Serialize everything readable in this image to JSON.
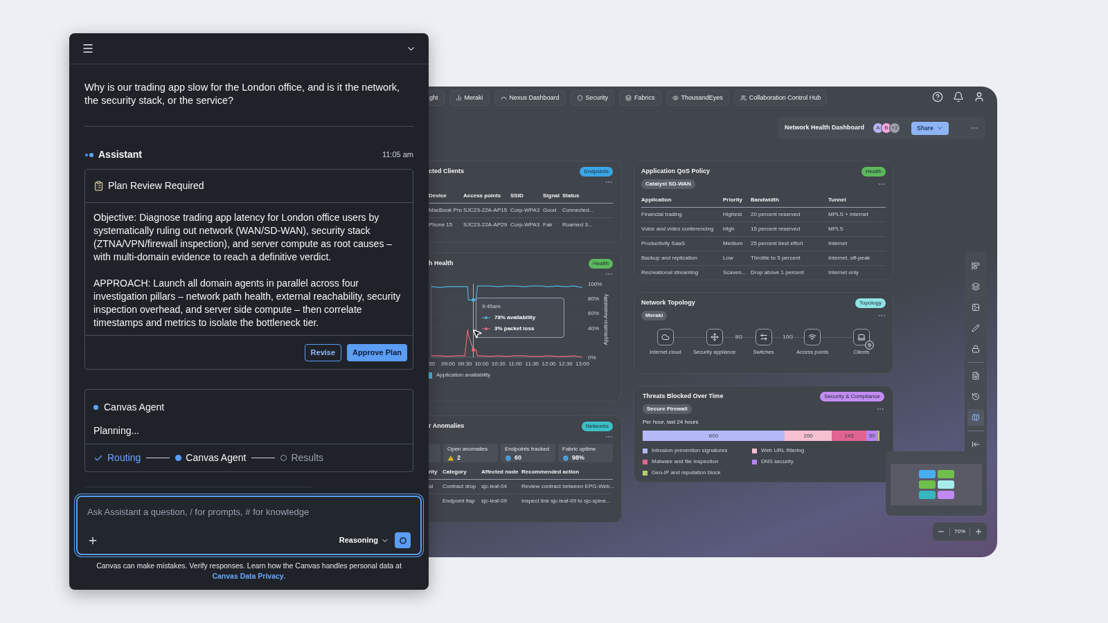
{
  "chat": {
    "question": "Why is our trading app slow for the London office, and is it the network, the security stack, or the service?",
    "assistant": {
      "name": "Assistant",
      "time": "11:05 am"
    },
    "plan": {
      "title": "Plan Review Required",
      "paragraphs": [
        "Objective: Diagnose trading app latency for London office users by systematically ruling out network (WAN/SD-WAN), security stack (ZTNA/VPN/firewall inspection), and server compute as root causes – with multi-domain evidence to reach a definitive verdict.",
        "APPROACH: Launch all domain agents in parallel across four investigation pillars – network path health, external reachability, security inspection overhead, and server side compute – then correlate timestamps and metrics to isolate the bottleneck tier."
      ],
      "buttons": [
        {
          "label": "Revise",
          "kind": "outline"
        },
        {
          "label": "Approve Plan",
          "kind": "primary"
        }
      ]
    },
    "agent": {
      "name": "Canvas Agent",
      "status": "Planning...",
      "steps": [
        {
          "label": "Routing",
          "done": true,
          "active": false
        },
        {
          "label": "Canvas Agent",
          "done": false,
          "active": true
        },
        {
          "label": "Results",
          "done": false,
          "active": false
        }
      ]
    },
    "input": {
      "placeholder": "Ask Assistant a question, / for prompts, # for knowledge",
      "mode": "Reasoning"
    },
    "footer": {
      "text": "Canvas can make mistakes. Verify responses. Learn how the Canvas handles personal data at",
      "link": "Canvas Data Privacy",
      "end": "."
    }
  },
  "dashboard": {
    "tabs": [
      "ght",
      "Meraki",
      "Nexus Dashboard",
      "Security",
      "Fabrics",
      "ThousandEyes",
      "Collaboration Control Hub"
    ],
    "header": {
      "title": "Network Health Dashboard",
      "avatars": [
        {
          "text": "A",
          "color": "#b8b5f3"
        },
        {
          "text": "B",
          "color": "#f2a7dc"
        },
        {
          "text": "+2",
          "color": "#9ca0a8"
        }
      ],
      "share": "Share"
    },
    "clients": {
      "title": "cted Clients",
      "badge": {
        "label": "Endpoints",
        "color": "#3aa6e6"
      },
      "columns": [
        "Device",
        "Access points",
        "SSID",
        "Signal",
        "Status"
      ],
      "rows": [
        [
          "MacBook Pro",
          "SJC23-22A-AP15",
          "Corp-WPA3",
          "Good",
          "Connected..."
        ],
        [
          "Phone 15",
          "SJC23-22A-AP29",
          "Corp-WPA3",
          "Fair",
          "Roamed 3..."
        ]
      ]
    },
    "health": {
      "title": "h Health",
      "cut_tick": "30",
      "badge": {
        "label": "Health",
        "color": "#5cb85c"
      },
      "tooltip": {
        "time": "9:45am",
        "lines": [
          "78% availability",
          "3% packet loss"
        ]
      },
      "chart_data": {
        "type": "line",
        "ylabel": "Application Availability",
        "xlim": [
          8.5,
          13
        ],
        "ylim": [
          0,
          100
        ],
        "x": [
          8.5,
          8.75,
          9,
          9.25,
          9.5,
          9.58,
          9.6,
          9.75,
          9.83,
          9.87,
          10,
          10.25,
          10.5,
          10.75,
          11,
          11.25,
          11.5,
          11.75,
          12,
          12.25,
          12.5,
          12.75,
          13
        ],
        "xticks": [
          {
            "value": 9,
            "label": "09:00"
          },
          {
            "value": 9.5,
            "label": "09:30"
          },
          {
            "value": 10,
            "label": "10:00"
          },
          {
            "value": 10.5,
            "label": "10:30"
          },
          {
            "value": 11,
            "label": "11:00"
          },
          {
            "value": 11.5,
            "label": "11:30"
          },
          {
            "value": 12,
            "label": "12:00"
          },
          {
            "value": 12.5,
            "label": "12:30"
          },
          {
            "value": 13,
            "label": "13:00"
          }
        ],
        "yticks": [
          {
            "value": 0,
            "label": "0%"
          },
          {
            "value": 40,
            "label": "40%"
          },
          {
            "value": 60,
            "label": "60%"
          },
          {
            "value": 80,
            "label": "80%"
          },
          {
            "value": 100,
            "label": "100%"
          }
        ],
        "legend": "bottom",
        "ref_lines": [
          {
            "axis": "x",
            "value": 9.75
          }
        ],
        "series": [
          {
            "name": "Application availability",
            "color": "#4fb3e0",
            "values": [
              96,
              95,
              96,
              96,
              96,
              96,
              78,
              78,
              78,
              97,
              97,
              97,
              96,
              97,
              97,
              96,
              97,
              97,
              96,
              97,
              96,
              97,
              95
            ]
          },
          {
            "color": "#e8687a",
            "values": [
              2,
              2,
              1,
              2,
              2,
              38,
              30,
              10,
              10,
              2,
              2,
              1,
              2,
              1,
              2,
              2,
              1,
              1,
              2,
              1,
              1,
              2,
              0
            ]
          }
        ]
      }
    },
    "anomalies": {
      "title": "r Anomalies",
      "badge": {
        "label": "Networks",
        "color": "#3cbfc4"
      },
      "stats": [
        {
          "label": "Open anomalies",
          "value": "2",
          "kind": "warning"
        },
        {
          "label": "Endpoints tracked",
          "value": "60",
          "kind": "ok"
        },
        {
          "label": "Fabric uptime",
          "value": "98%",
          "kind": "ok"
        }
      ],
      "columns": [
        "rity",
        "Category",
        "Affected node",
        "Recommended action"
      ],
      "rows": [
        [
          "al",
          "Contract drop",
          "sjc-leaf-04",
          "Review contract between EPG-Web..."
        ],
        [
          "",
          "Endpoint flap",
          "sjc-leaf-09",
          "Inspect link sjc-leaf-09 to sjc-spine..."
        ]
      ]
    },
    "qos": {
      "title": "Application QoS Policy",
      "badge": {
        "label": "Health",
        "color": "#5cb85c"
      },
      "source": "Catalyst SD-WAN",
      "columns": [
        "Application",
        "Priority",
        "Bandwidth",
        "Tunnel"
      ],
      "rows": [
        [
          "Financial trading",
          "Highest",
          "20 percent reserved",
          "MPLS + Internet"
        ],
        [
          "Voice and video conferencing",
          "High",
          "15 percent reserved",
          "MPLS"
        ],
        [
          "Productivity SaaS",
          "Medium",
          "25 percent best effort",
          "Internet"
        ],
        [
          "Backup and replication",
          "Low",
          "Throttle to 5 percent",
          "Internet, off-peak"
        ],
        [
          "Recreational streaming",
          "Scaven...",
          "Drop above 1 percent",
          "Internet only"
        ]
      ]
    },
    "topology": {
      "title": "Network Topology",
      "badge": {
        "label": "Topology",
        "color": "#8fe3e3"
      },
      "source": "Meraki",
      "nodes": [
        {
          "label": "Internet cloud"
        },
        {
          "label": "Security appliance",
          "link": "8G"
        },
        {
          "label": "Switches",
          "link": "10G"
        },
        {
          "label": "Access points"
        },
        {
          "label": "Clients",
          "count": "9"
        }
      ]
    },
    "threats": {
      "title": "Threats Blocked Over Time",
      "badge": {
        "label": "Security & Compliance",
        "color": "#c28bf2"
      },
      "source": "Secure Firewall",
      "chart_data": {
        "type": "bar",
        "orientation": "horizontal",
        "stacked": true,
        "title": "Per hour, last 24 hours",
        "legend": "bottom",
        "categories": [
          null
        ],
        "series": [
          {
            "name": "Intrusion prevention signatures",
            "color": "#b3b8f7",
            "values": [
              600
            ],
            "value_labels": [
              "600"
            ]
          },
          {
            "name": "Web URL filtering",
            "color": "#f6c0d0",
            "values": [
              200
            ],
            "value_labels": [
              "200"
            ]
          },
          {
            "name": "Malware and file inspection",
            "color": "#e0648f",
            "values": [
              145
            ],
            "value_labels": [
              "145"
            ]
          },
          {
            "name": "DNS security",
            "color": "#b784f2",
            "values": [
              50
            ],
            "value_labels": [
              "50"
            ]
          },
          {
            "name": "Geo-IP and reputation block",
            "color": "#b8cc6c",
            "values": [
              6
            ],
            "value_labels": [
              null
            ]
          }
        ]
      }
    },
    "toolbar": [
      [
        {
          "selected": false
        },
        {
          "selected": false
        },
        {
          "selected": false
        },
        {
          "selected": false
        },
        {
          "selected": false
        }
      ],
      [
        {
          "selected": false
        },
        {
          "selected": false
        },
        {
          "selected": true
        }
      ],
      [
        {
          "selected": false
        }
      ]
    ],
    "zoom": "70%"
  }
}
